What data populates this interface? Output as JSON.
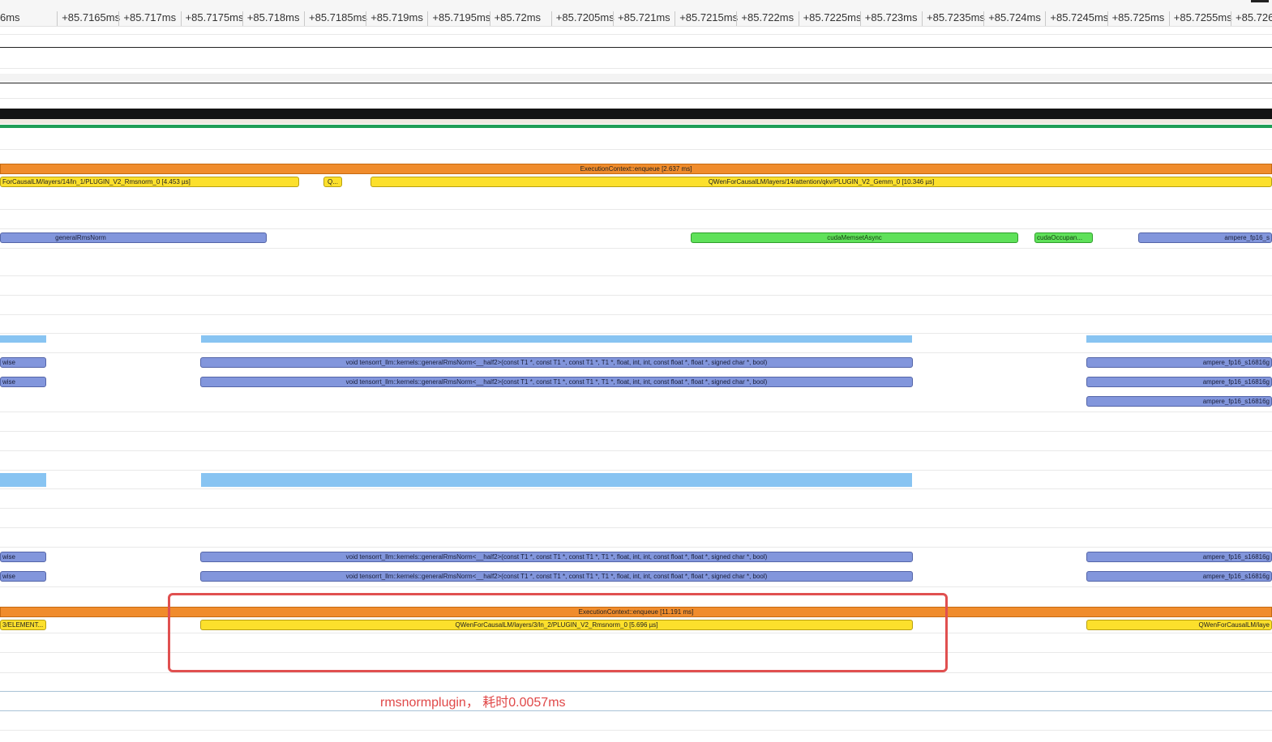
{
  "ruler": {
    "ticks": [
      "6ms",
      "+85.7165ms",
      "+85.717ms",
      "+85.7175ms",
      "+85.718ms",
      "+85.7185ms",
      "+85.719ms",
      "+85.7195ms",
      "+85.72ms",
      "+85.7205ms",
      "+85.721ms",
      "+85.7215ms",
      "+85.722ms",
      "+85.7225ms",
      "+85.723ms",
      "+85.7235ms",
      "+85.724ms",
      "+85.7245ms",
      "+85.725ms",
      "+85.7255ms",
      "+85.726ms"
    ]
  },
  "colors": {
    "enqueue": "#f08c2c",
    "plugin": "#fce02c",
    "kernel": "#8296dc",
    "memset": "#5fe15a",
    "activity": "#88c4f2",
    "highlight": "#e05050"
  },
  "track1": {
    "enqueue": "ExecutionContext::enqueue [2.637 ms]",
    "rmsnorm_plugin": "ForCausalLM/layers/14/ln_1/PLUGIN_V2_Rmsnorm_0 [4.453 µs]",
    "small_plugin": "Q...",
    "gemm_plugin": "QWenForCausalLM/layers/14/attention/qkv/PLUGIN_V2_Gemm_0 [10.346 µs]"
  },
  "cuda_api": {
    "general_rms_norm": "generalRmsNorm",
    "memset": "cudaMemsetAsync",
    "occupancy": "cudaOccupan...",
    "ampere": "ampere_fp16_s"
  },
  "kernels_a": {
    "left": "wise",
    "rmsnorm": "void tensorrt_llm::kernels::generalRmsNorm<__half2>(const T1 *, const T1 *, const T1 *, T1 *, float, int, int, const float *, float *, signed char *, bool)",
    "ampere": "ampere_fp16_s16816g"
  },
  "kernels_b": {
    "left": "wise",
    "rmsnorm": "void tensorrt_llm::kernels::generalRmsNorm<__half2>(const T1 *, const T1 *, const T1 *, T1 *, float, int, int, const float *, float *, signed char *, bool)",
    "ampere": "ampere_fp16_s16816g"
  },
  "track2": {
    "enqueue": "ExecutionContext::enqueue [11.191 ms]",
    "left_plugin": "3/ELEMENT...",
    "rmsnorm_plugin": "QWenForCausalLM/layers/3/ln_2/PLUGIN_V2_Rmsnorm_0 [5.696 µs]",
    "right_plugin": "QWenForCausalLM/laye"
  },
  "annotation": {
    "text": "rmsnormplugin， 耗时0.0057ms"
  }
}
